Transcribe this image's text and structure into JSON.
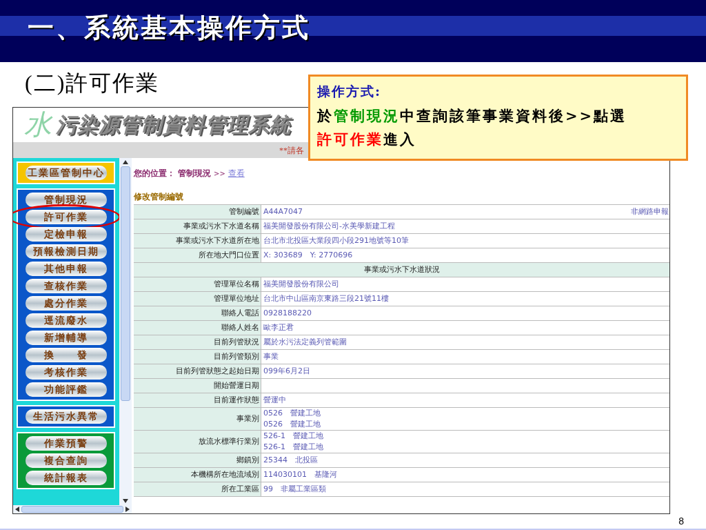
{
  "slide": {
    "title": "一、系統基本操作方式",
    "subtitle": "(二)許可作業",
    "page_number": "8"
  },
  "callout": {
    "heading": "操作方式:",
    "segments": [
      {
        "text": "於",
        "color": "#000000"
      },
      {
        "text": "管制現況",
        "color": "#009900"
      },
      {
        "text": "中查詢該筆事業資料後>>點選",
        "color": "#000000"
      },
      {
        "text": "許可作業",
        "color": "#ff0000"
      },
      {
        "text": "進入",
        "color": "#000000"
      }
    ]
  },
  "app": {
    "logo_mark": "水",
    "logo_title": "污染源管制資料管理系統",
    "notice": "**請各",
    "sidebar": [
      {
        "kind": "yellow",
        "items": [
          {
            "label": "工業區管制中心",
            "highlighted": false
          }
        ]
      },
      {
        "kind": "blue",
        "items": [
          {
            "label": "管制現況",
            "highlighted": false
          },
          {
            "label": "許可作業",
            "highlighted": true
          },
          {
            "label": "定檢申報",
            "highlighted": false
          },
          {
            "label": "預報檢測日期",
            "highlighted": false
          },
          {
            "label": "其他申報",
            "highlighted": false
          },
          {
            "label": "查核作業",
            "highlighted": false
          },
          {
            "label": "處分作業",
            "highlighted": false
          },
          {
            "label": "逕流廢水",
            "highlighted": false
          },
          {
            "label": "新增輔導",
            "highlighted": false
          },
          {
            "label": "換　　發",
            "highlighted": false
          },
          {
            "label": "考核作業",
            "highlighted": false
          },
          {
            "label": "功能評鑑",
            "highlighted": false
          }
        ]
      },
      {
        "kind": "blue",
        "items": [
          {
            "label": "生活污水異常",
            "highlighted": false
          }
        ]
      },
      {
        "kind": "green",
        "items": [
          {
            "label": "作業預警",
            "highlighted": false
          },
          {
            "label": "複合查詢",
            "highlighted": false
          },
          {
            "label": "統計報表",
            "highlighted": false
          }
        ]
      }
    ],
    "breadcrumb": {
      "label": "您的位置：",
      "current": "管制現況",
      "separator": ">>",
      "link": "查看"
    },
    "section_title": "修改管制編號",
    "rows": [
      {
        "kind": "field",
        "label": "管制編號",
        "values": [
          "A44A7047"
        ],
        "note": "非網路申報"
      },
      {
        "kind": "field",
        "label": "事業或污水下水道名稱",
        "values": [
          "福美開發股份有限公司-水美學新建工程"
        ]
      },
      {
        "kind": "field",
        "label": "事業或污水下水道所在地",
        "values": [
          "台北市北投區大業段四小段291地號等10筆"
        ]
      },
      {
        "kind": "field",
        "label": "所在地大門口位置",
        "values": [
          "X: 303689　Y: 2770696"
        ]
      },
      {
        "kind": "section",
        "label": "事業或污水下水道狀況"
      },
      {
        "kind": "field",
        "label": "管理單位名稱",
        "values": [
          "福美開發股份有限公司"
        ]
      },
      {
        "kind": "field",
        "label": "管理單位地址",
        "values": [
          "台北市中山區南京東路三段21號11樓"
        ]
      },
      {
        "kind": "field",
        "label": "聯絡人電話",
        "values": [
          "0928188220"
        ]
      },
      {
        "kind": "field",
        "label": "聯絡人姓名",
        "values": [
          "歐李正君"
        ]
      },
      {
        "kind": "field",
        "label": "目前列管狀況",
        "values": [
          "屬於水污法定義列管範圍"
        ]
      },
      {
        "kind": "field",
        "label": "目前列管類別",
        "values": [
          "事業"
        ]
      },
      {
        "kind": "field",
        "label": "目前列管狀態之起始日期",
        "values": [
          "099年6月2日"
        ]
      },
      {
        "kind": "field",
        "label": "開始營運日期",
        "values": []
      },
      {
        "kind": "field",
        "label": "目前運作狀態",
        "values": [
          "營運中"
        ]
      },
      {
        "kind": "field",
        "label": "事業別",
        "values": [
          "0526　營建工地",
          "0526　營建工地"
        ]
      },
      {
        "kind": "field",
        "label": "放流水標準行業別",
        "values": [
          "526-1　營建工地",
          "526-1　營建工地"
        ]
      },
      {
        "kind": "field",
        "label": "鄉鎮別",
        "values": [
          "25344　北投區"
        ]
      },
      {
        "kind": "field",
        "label": "本機構所在地流域別",
        "values": [
          "114030101　基隆河"
        ]
      },
      {
        "kind": "field",
        "label": "所在工業區",
        "values": [
          "99　非屬工業區類"
        ]
      }
    ]
  }
}
